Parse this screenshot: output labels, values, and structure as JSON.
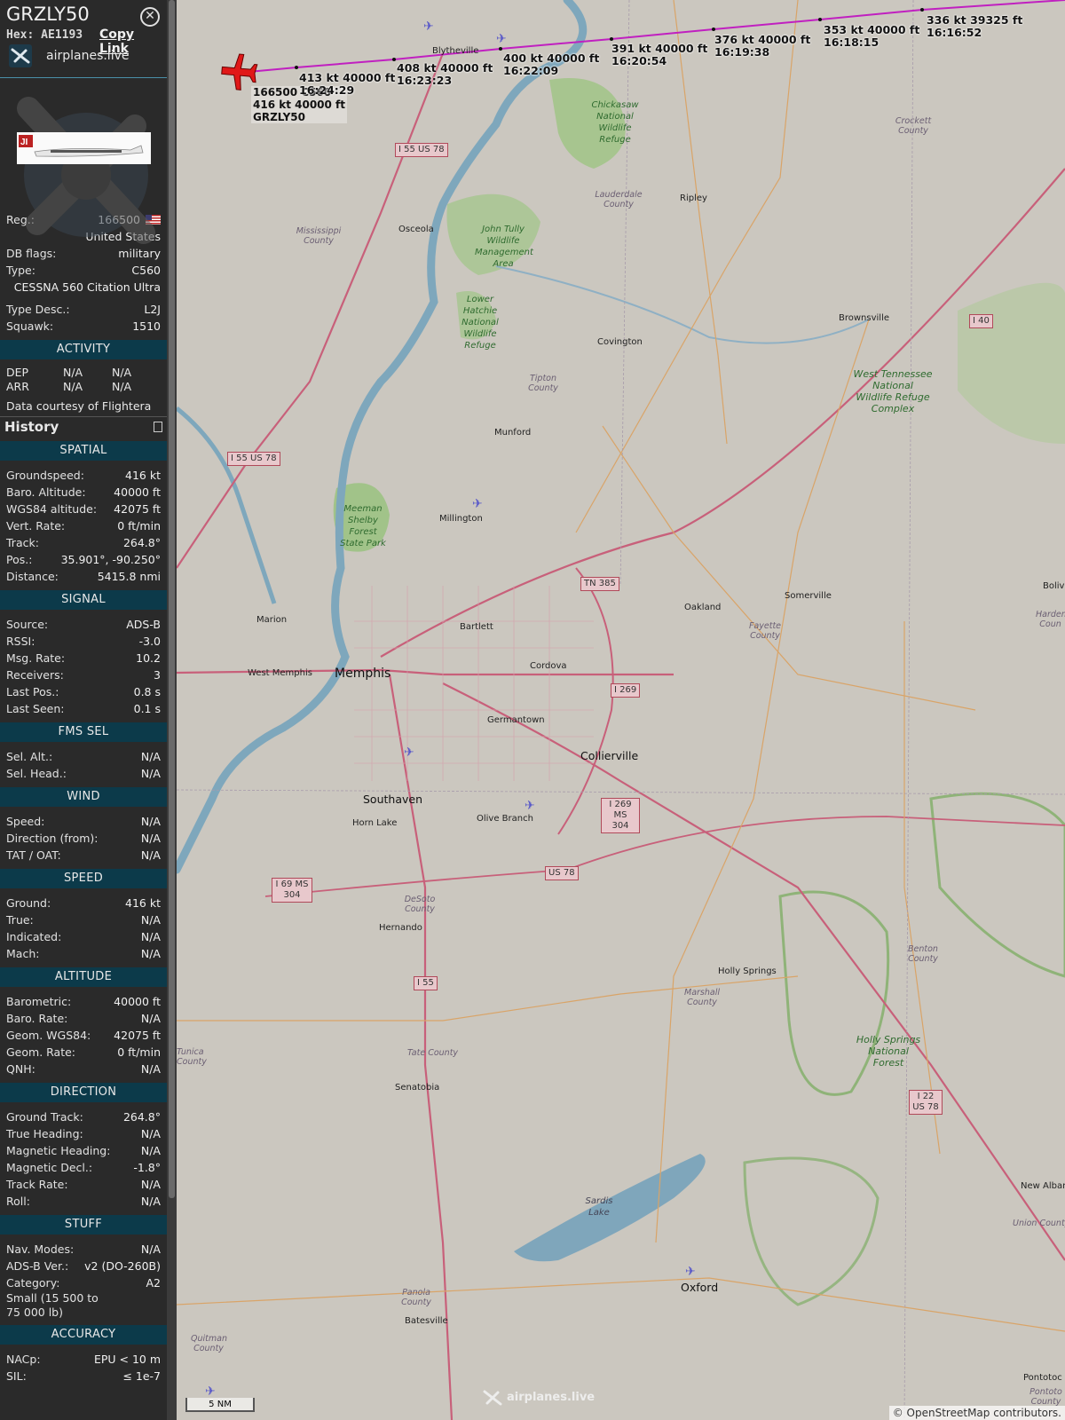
{
  "aircraft": {
    "callsign": "GRZLY50",
    "hex_label": "Hex:",
    "hex": "AE1193",
    "copy_link": "Copy Link",
    "provider": "airplanes.live"
  },
  "info": {
    "reg_label": "Reg.:",
    "reg": "166500",
    "country": "United States",
    "dbflags_label": "DB flags:",
    "dbflags": "military",
    "type_label": "Type:",
    "type": "C560",
    "type_name": "CESSNA 560 Citation Ultra",
    "typedesc_label": "Type Desc.:",
    "typedesc": "L2J",
    "squawk_label": "Squawk:",
    "squawk": "1510"
  },
  "activity": {
    "title": "ACTIVITY",
    "dep_label": "DEP",
    "dep_1": "N/A",
    "dep_2": "N/A",
    "arr_label": "ARR",
    "arr_1": "N/A",
    "arr_2": "N/A",
    "courtesy_prefix": "Data courtesy of",
    "courtesy_source": "Flightera"
  },
  "history_label": "History",
  "sections": [
    {
      "title": "SPATIAL",
      "rows": [
        {
          "k": "Groundspeed:",
          "v": "416 kt"
        },
        {
          "k": "Baro. Altitude:",
          "v": "40000 ft"
        },
        {
          "k": "WGS84 altitude:",
          "v": "42075 ft"
        },
        {
          "k": "Vert. Rate:",
          "v": "0 ft/min"
        },
        {
          "k": "Track:",
          "v": "264.8°"
        },
        {
          "k": "Pos.:",
          "v": "35.901°, -90.250°"
        },
        {
          "k": "Distance:",
          "v": "5415.8 nmi"
        }
      ]
    },
    {
      "title": "SIGNAL",
      "rows": [
        {
          "k": "Source:",
          "v": "ADS-B"
        },
        {
          "k": "RSSI:",
          "v": "-3.0"
        },
        {
          "k": "Msg. Rate:",
          "v": "10.2"
        },
        {
          "k": "Receivers:",
          "v": "3"
        },
        {
          "k": "Last Pos.:",
          "v": "0.8 s"
        },
        {
          "k": "Last Seen:",
          "v": "0.1 s"
        }
      ]
    },
    {
      "title": "FMS SEL",
      "rows": [
        {
          "k": "Sel. Alt.:",
          "v": "N/A"
        },
        {
          "k": "Sel. Head.:",
          "v": "N/A"
        }
      ]
    },
    {
      "title": "WIND",
      "rows": [
        {
          "k": "Speed:",
          "v": "N/A"
        },
        {
          "k": "Direction (from):",
          "v": "N/A"
        },
        {
          "k": "TAT / OAT:",
          "v": "N/A"
        }
      ]
    },
    {
      "title": "SPEED",
      "rows": [
        {
          "k": "Ground:",
          "v": "416 kt"
        },
        {
          "k": "True:",
          "v": "N/A"
        },
        {
          "k": "Indicated:",
          "v": "N/A"
        },
        {
          "k": "Mach:",
          "v": "N/A"
        }
      ]
    },
    {
      "title": "ALTITUDE",
      "rows": [
        {
          "k": "Barometric:",
          "v": "40000 ft"
        },
        {
          "k": "Baro. Rate:",
          "v": "N/A"
        },
        {
          "k": "Geom. WGS84:",
          "v": "42075 ft"
        },
        {
          "k": "Geom. Rate:",
          "v": "0 ft/min"
        },
        {
          "k": "QNH:",
          "v": "N/A"
        }
      ]
    },
    {
      "title": "DIRECTION",
      "rows": [
        {
          "k": "Ground Track:",
          "v": "264.8°"
        },
        {
          "k": "True Heading:",
          "v": "N/A"
        },
        {
          "k": "Magnetic Heading:",
          "v": "N/A"
        },
        {
          "k": "Magnetic Decl.:",
          "v": "-1.8°"
        },
        {
          "k": "Track Rate:",
          "v": "N/A"
        },
        {
          "k": "Roll:",
          "v": "N/A"
        }
      ]
    },
    {
      "title": "STUFF",
      "rows": [
        {
          "k": "Nav. Modes:",
          "v": "N/A"
        },
        {
          "k": "ADS-B Ver.:",
          "v": "v2 (DO-260B)"
        },
        {
          "k": "Category:",
          "v": "A2"
        },
        {
          "k": "Small (15 500 to 75 000 lb)",
          "v": ""
        }
      ]
    },
    {
      "title": "ACCURACY",
      "rows": [
        {
          "k": "NACp:",
          "v": "EPU < 10 m"
        },
        {
          "k": "SIL:",
          "v": "≤ 1e-7"
        }
      ]
    }
  ],
  "map": {
    "aircraft_label": [
      "166500 C560",
      "416 kt  40000 ft",
      "GRZLY50"
    ],
    "track_labels": [
      {
        "speed_alt": "413 kt  40000 ft",
        "time": "16:24:29"
      },
      {
        "speed_alt": "408 kt  40000 ft",
        "time": "16:23:23"
      },
      {
        "speed_alt": "400 kt  40000 ft",
        "time": "16:22:09"
      },
      {
        "speed_alt": "391 kt  40000 ft",
        "time": "16:20:54"
      },
      {
        "speed_alt": "376 kt  40000 ft",
        "time": "16:19:38"
      },
      {
        "speed_alt": "353 kt  40000 ft",
        "time": "16:18:15"
      },
      {
        "speed_alt": "336 kt  39325 ft",
        "time": "16:16:52"
      }
    ],
    "cities": [
      "Blytheville",
      "Osceola",
      "Ripley",
      "Brownsville",
      "Covington",
      "Munford",
      "Millington",
      "Marion",
      "Bartlett",
      "West Memphis",
      "Memphis",
      "Cordova",
      "Germantown",
      "Collierville",
      "Oakland",
      "Somerville",
      "Southaven",
      "Horn Lake",
      "Olive Branch",
      "Hernando",
      "Holly Springs",
      "Senatobia",
      "Batesville",
      "Oxford",
      "New Albany",
      "Pontotoc",
      "Boliva"
    ],
    "counties": [
      "Crockett County",
      "Lauderdale County",
      "Mississippi County",
      "Tipton County",
      "Fayette County",
      "DeSoto County",
      "Marshall County",
      "Tate County",
      "Benton County",
      "Union County",
      "Panola County",
      "Quitman County",
      "Hardem Coun",
      "Pontoto County",
      "Tunica County"
    ],
    "parks": [
      "Chickasaw National Wildlife Refuge",
      "John Tully Wildlife Management Area",
      "Lower Hatchie National Wildlife Refuge",
      "West Tennessee National Wildlife Refuge Complex",
      "Meeman Shelby Forest State Park",
      "Holly Springs National Forest",
      "Sardis Lake"
    ],
    "shields": [
      "I 55 US 78",
      "I 55 US 78",
      "TN 385",
      "I 269",
      "I 269 MS 304",
      "US 78",
      "I 69 MS 304",
      "I 55",
      "I 40",
      "I 22 US 78"
    ],
    "scale": "5 NM",
    "copyright": "© OpenStreetMap contributors.",
    "watermark": "airplanes.live"
  },
  "colors": {
    "track": "#c020c0",
    "aircraft": "#e01818",
    "section": "#0c3a4a",
    "sidebar": "#2a2a2a"
  }
}
